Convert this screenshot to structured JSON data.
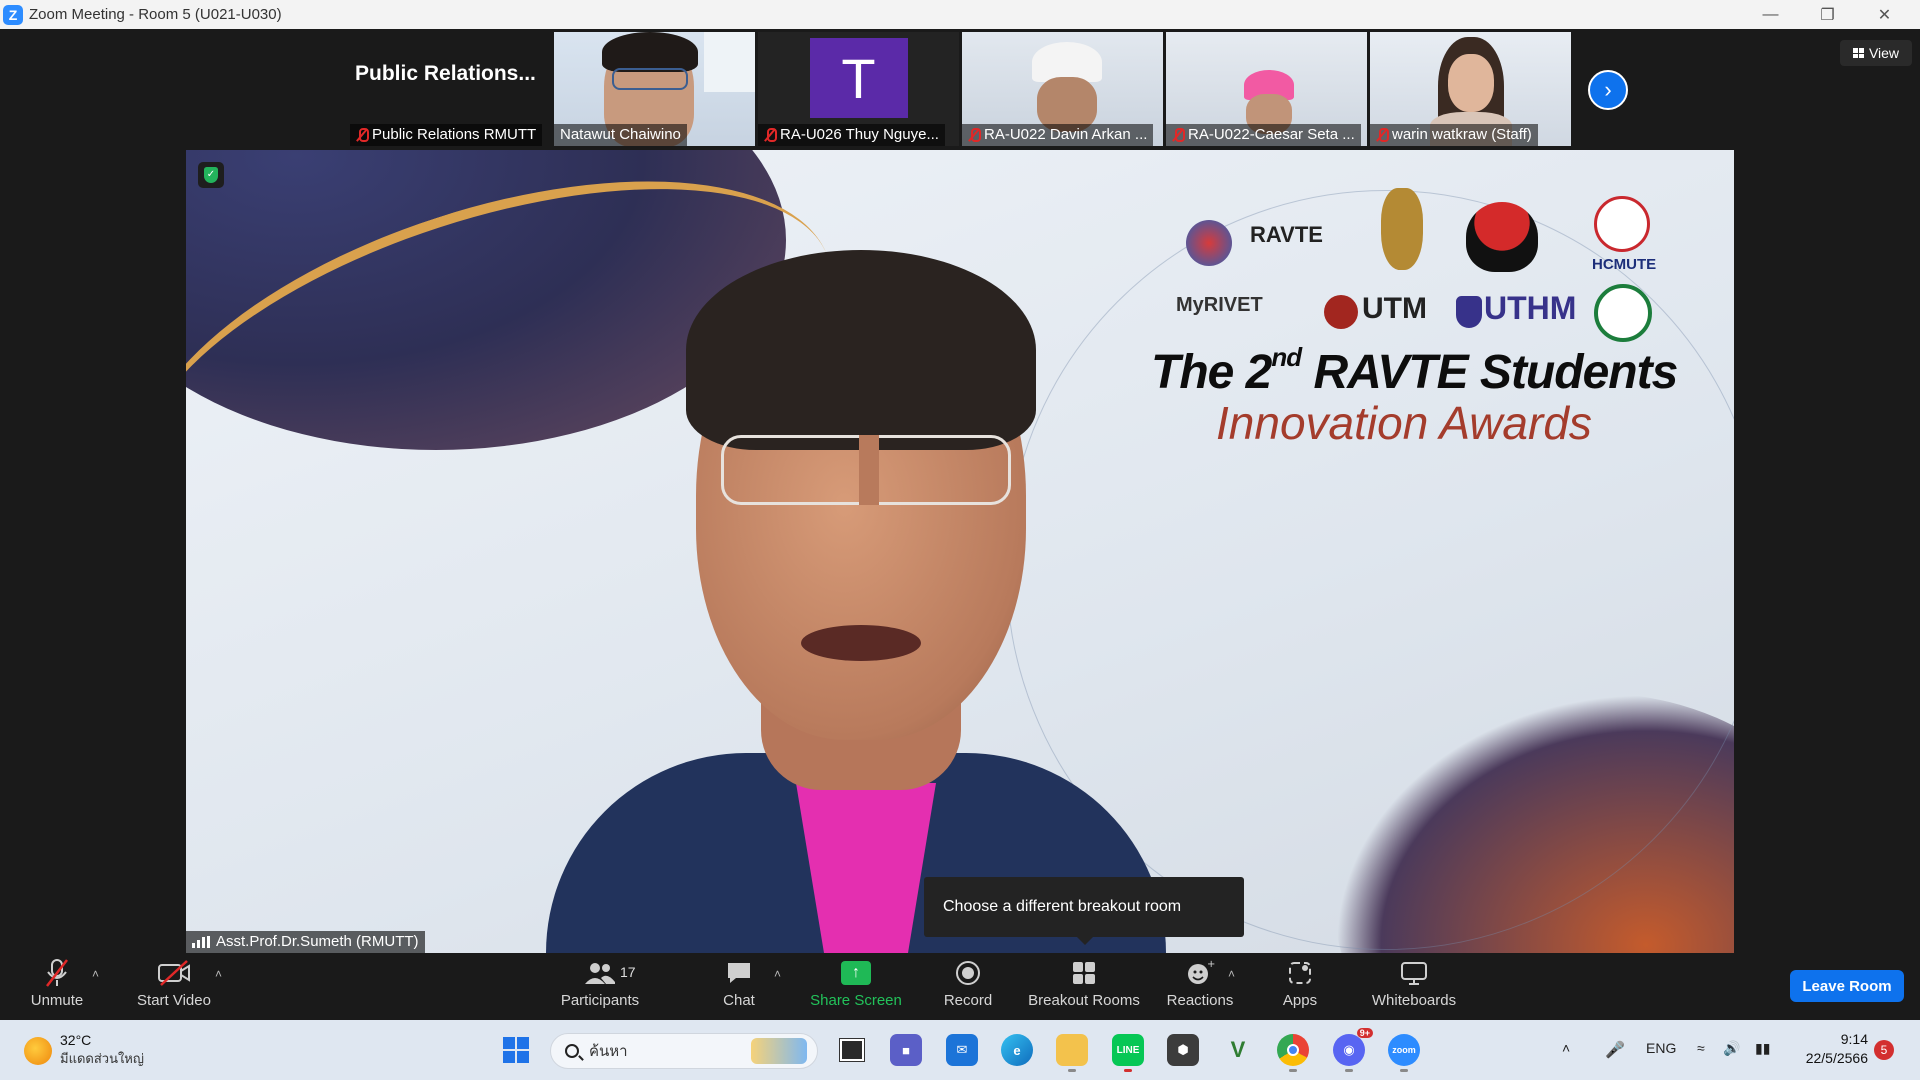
{
  "window": {
    "app_logo": "Z",
    "title": "Zoom Meeting - Room 5 (U021-U030)",
    "controls": [
      "minimize-icon",
      "restore-icon",
      "close-icon"
    ]
  },
  "gallery": {
    "tiles": [
      {
        "name": "Public Relations RMUTT",
        "display_name": "Public  Relations...",
        "muted": true,
        "kind": "name-only"
      },
      {
        "name": "Natawut Chaiwino",
        "muted": false,
        "kind": "video"
      },
      {
        "name": "RA-U026 Thuy Nguye...",
        "muted": true,
        "kind": "letter",
        "letter": "T"
      },
      {
        "name": "RA-U022 Davin Arkan ...",
        "muted": true,
        "kind": "video"
      },
      {
        "name": "RA-U022-Caesar Seta ...",
        "muted": true,
        "kind": "video"
      },
      {
        "name": "warin watkraw (Staff)",
        "muted": true,
        "kind": "video"
      }
    ],
    "next_icon": "chevron-right-icon",
    "view_label": "View"
  },
  "main": {
    "speaker": "Asst.Prof.Dr.Sumeth (RMUTT)",
    "slide": {
      "logos": [
        "RAVTE",
        "MyRIVET",
        "UTM",
        "UTHM",
        "HCMUTE"
      ],
      "title_prefix": "The 2",
      "title_sup": "nd",
      "title_suffix": " RAVTE Students",
      "subtitle": "Innovation Awards"
    }
  },
  "tooltip": "Choose a different breakout room",
  "toolbar": {
    "unmute": "Unmute",
    "start_video": "Start Video",
    "participants": "Participants",
    "participants_count": "17",
    "chat": "Chat",
    "share_screen": "Share Screen",
    "record": "Record",
    "breakout_rooms": "Breakout Rooms",
    "reactions": "Reactions",
    "apps": "Apps",
    "whiteboards": "Whiteboards",
    "leave": "Leave Room"
  },
  "taskbar": {
    "weather_temp": "32°C",
    "weather_desc": "มีแดดส่วนใหญ่",
    "search_placeholder": "ค้นหา",
    "apps": [
      "file-explorer-icon",
      "teams-icon",
      "mail-icon",
      "edge-icon",
      "folder-icon",
      "line-icon",
      "app-icon",
      "vim-icon",
      "chrome-icon",
      "discord-icon",
      "zoom-icon"
    ],
    "line_label": "LINE",
    "zoom_label": "zoom",
    "discord_badge": "9+",
    "language": "ENG",
    "time": "9:14",
    "date": "22/5/2566",
    "notification_count": "5"
  },
  "colors": {
    "zoom_blue": "#0e72ed",
    "share_green": "#1fb956",
    "muted_red": "#e02828",
    "toolbar_bg": "#1a1a1a"
  }
}
